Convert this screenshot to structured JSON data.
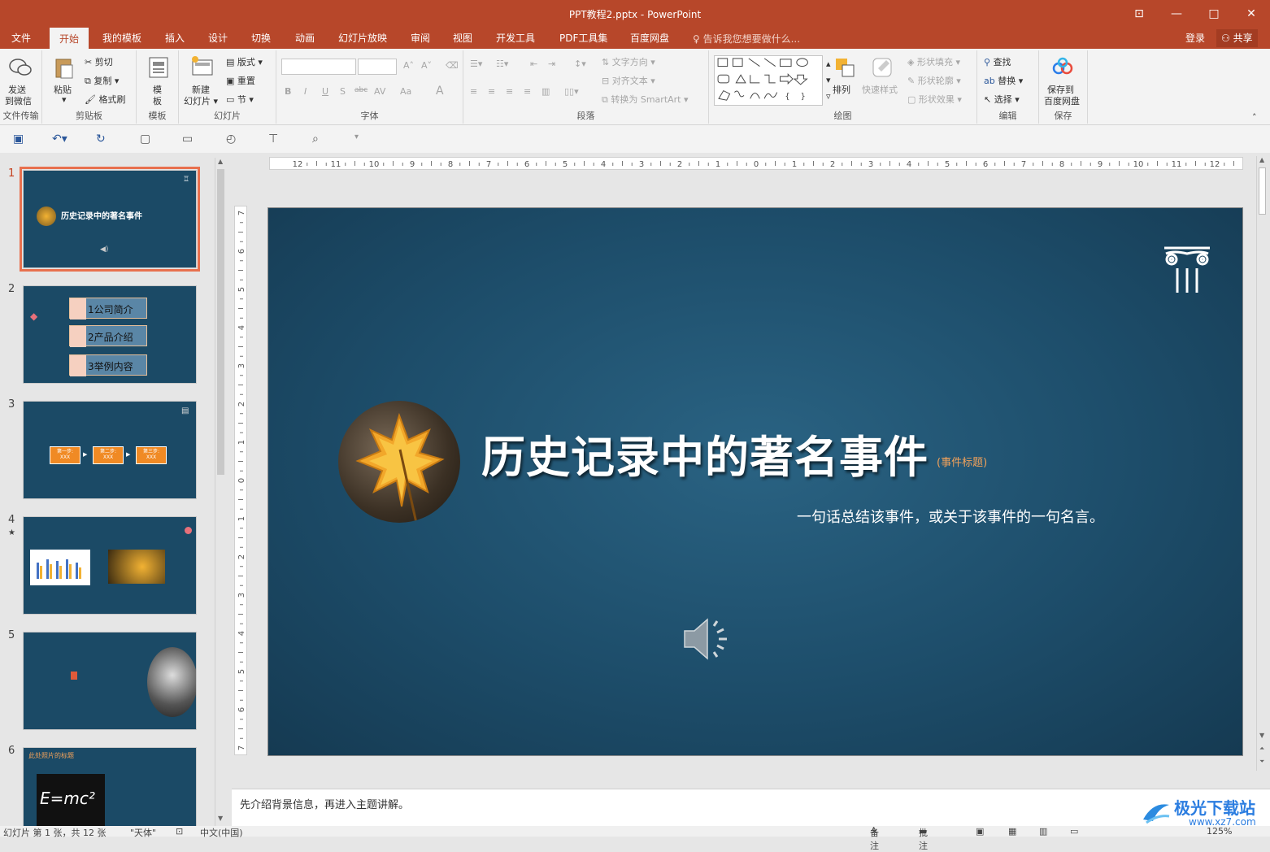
{
  "window": {
    "title": "PPT教程2.pptx - PowerPoint",
    "restore_glyph": "⊡",
    "minimize_glyph": "—",
    "maximize_glyph": "□",
    "close_glyph": "✕"
  },
  "menu": {
    "tabs": [
      "文件",
      "开始",
      "我的模板",
      "插入",
      "设计",
      "切换",
      "动画",
      "幻灯片放映",
      "审阅",
      "视图",
      "开发工具",
      "PDF工具集",
      "百度网盘"
    ],
    "active": "开始",
    "tell_me": "告诉我您想要做什么...",
    "login": "登录",
    "share": "共享"
  },
  "ribbon": {
    "groups": {
      "file_transfer": "文件传输",
      "clipboard": "剪贴板",
      "template": "模板",
      "slides": "幻灯片",
      "font": "字体",
      "paragraph": "段落",
      "drawing": "绘图",
      "editing": "编辑",
      "save": "保存"
    },
    "send_wechat_1": "发送",
    "send_wechat_2": "到微信",
    "paste": "粘贴",
    "cut": "剪切",
    "copy": "复制",
    "format_painter": "格式刷",
    "template_1": "模",
    "template_2": "板",
    "new_slide_1": "新建",
    "new_slide_2": "幻灯片",
    "layout": "版式",
    "reset": "重置",
    "section": "节",
    "bold": "B",
    "italic": "I",
    "underline": "U",
    "shadow": "S",
    "strike": "abc",
    "spacing": "AV",
    "case": "Aa",
    "text_direction": "文字方向",
    "align_text": "对齐文本",
    "convert_smartart": "转换为 SmartArt",
    "arrange": "排列",
    "quick_styles": "快速样式",
    "shape_fill": "形状填充",
    "shape_outline": "形状轮廓",
    "shape_effects": "形状效果",
    "find": "查找",
    "replace": "替换",
    "select": "选择",
    "save_baidu_1": "保存到",
    "save_baidu_2": "百度网盘"
  },
  "slides_panel": {
    "numbers": [
      "1",
      "2",
      "3",
      "4",
      "5",
      "6"
    ],
    "slide4_mark": "★",
    "thumb1_title": "历史记录中的著名事件",
    "thumb2_items": [
      "1公司简介",
      "2产品介绍",
      "3举例内容"
    ],
    "thumb3_steps": [
      "第一步:",
      "第二步:",
      "第三步:"
    ],
    "thumb3_step_sub": "XXX",
    "thumb6_title": "此处照片的标题",
    "thumb6_formula": "E=mc²"
  },
  "slide": {
    "title": "历史记录中的著名事件",
    "subtitle": "(事件标题)",
    "quote": "一句话总结该事件，或关于该事件的一句名言。"
  },
  "notes": "先介绍背景信息，再进入主题讲解。",
  "status": {
    "slide_info": "幻灯片 第 1 张，共 12 张",
    "font": "\"天体\"",
    "language": "中文(中国)",
    "notes": "备注",
    "comments": "批注",
    "zoom": "125%"
  },
  "watermark": {
    "name": "极光下载站",
    "url": "www.xz7.com"
  },
  "colors": {
    "accent": "#b7472a",
    "slide_bg": "#1d4d6a",
    "selection": "#e8704e"
  }
}
